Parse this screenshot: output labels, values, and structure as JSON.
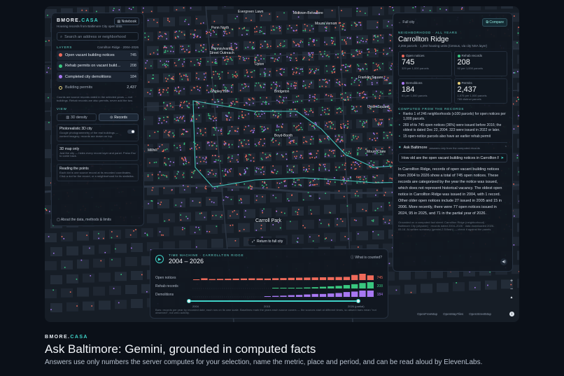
{
  "colors": {
    "accent": "#3fd2c7",
    "open_notices": "#ef6a5a",
    "rehab": "#39c77f",
    "demolitions": "#a878f2",
    "permits": "#e9d27a"
  },
  "map": {
    "place_labels": [
      "Evergreen Lawn",
      "Midtown-Belvedere",
      "Mount Vernon",
      "Penn North",
      "Pennsylvania Street Outreach",
      "Upton",
      "Shipley Hill",
      "Bridgeton",
      "Franklin Square",
      "Union Square",
      "Millhill",
      "Boyd-Booth",
      "Mount Clare",
      "Carroll Park"
    ],
    "return_button": "Return to full city",
    "zoom_in": "+",
    "zoom_out": "−",
    "compass": "▲",
    "attribution": [
      "OpenFreeMap",
      "OpenMapTiles",
      "OpenStreetMap"
    ],
    "info": "i"
  },
  "left": {
    "brand_a": "BMORE.",
    "brand_b": "CASA",
    "subtitle": "Housing records from Baltimore City open data",
    "notebook": "Notebook",
    "search_placeholder": "Search an address or neighborhood",
    "layers_title": "LAYERS",
    "layers_scope": "Carrollton Ridge · 2004–2026",
    "layers": [
      {
        "label": "Open vacant building notices",
        "count": "745",
        "color": "#ef6a5a"
      },
      {
        "label": "Rehab permits on vacant build…",
        "count": "208",
        "color": "#39c77f"
      },
      {
        "label": "Completed city demolitions",
        "count": "184",
        "color": "#a878f2"
      },
      {
        "label": "Building permits",
        "count": "2,437",
        "color": "#e9d27a"
      }
    ],
    "layers_note": "Counts are source records dated in the selected years — not buildings. Rehab records are also permits, never add the two.",
    "view_title": "VIEW",
    "view_density": "3D density",
    "view_records": "Records",
    "photo_title": "Photorealistic 3D city",
    "photo_desc": "Google photogrammetry of the real buildings — context imagery; records are drawn on top.",
    "maponly_title": "3D map only",
    "maponly_desc": "Just the city — hides every record layer and panel. Press Esc to come back.",
    "reading_title": "Reading the points",
    "reading_desc": "Each dot is one source record at its recorded coordinates. Click a dot for the record, or a neighborhood for its statistics.",
    "about": "About the data, methods & limits"
  },
  "right": {
    "back": "Full city",
    "compare": "Compare",
    "eyebrow": "NEIGHBORHOOD · ALL YEARS",
    "name": "Carrollton Ridge",
    "stats_line": "2,266 parcels · 1,283 housing units (Census, via city NSA layer)",
    "cards": [
      {
        "label": "Open notices",
        "value": "745",
        "sub": "329 per 1,000 parcels",
        "color": "#ef6a5a"
      },
      {
        "label": "Rehab records",
        "value": "208",
        "sub": "92 per 1,000 parcels",
        "color": "#39c77f"
      },
      {
        "label": "Demolitions",
        "value": "184",
        "sub": "81 per 1,000 parcels",
        "color": "#a878f2"
      },
      {
        "label": "Permits",
        "value": "2,437",
        "sub": "1,075 per 1,000 parcels",
        "sub2": "765 distinct parcels",
        "color": "#e9d27a"
      }
    ],
    "computed_title": "COMPUTED FROM THE RECORDS",
    "bullets": [
      "Ranks 1 of 246 neighborhoods (x100 parcels) for open notices per 1,000 parcels.",
      "269 of its 745 open notices (36%) were issued before 2016; the oldest is dated Dec 22, 2004. 323 were issued in 2022 or later.",
      "15 open-notice parcels also have an earlier rehab permit"
    ],
    "ask_title": "Ask Baltimore",
    "ask_meta": "answers only from the computed records",
    "question": "How old are the open vacant building notices in Carrollton Ridge?",
    "answer": "In Carrollton Ridge, records of open vacant building notices from 2004 to 2026 show a total of 745 open notices. These records are categorized by the year the notice was issued, which does not represent historical vacancy. The oldest open notice in Carrollton Ridge was issued in 2004, with 1 record. Other older open notices include 27 issued in 2005 and 15 in 2006. More recently, there were 77 open notices issued in 2024, 95 in 2025, and 71 in the partial year of 2026.",
    "footnote": "Grounded on a computed fact sheet: Carrollton Ridge (neighborhood) · Baltimore City (citywide) · records dated 2004–2026 · data downloaded 2026-05-16. AI-written summary (gemini-2.5-flash) — check it against the panels."
  },
  "time_machine": {
    "eyebrow": "TIME MACHINE · CARROLLTON RIDGE",
    "range": "2004 – 2026",
    "what": "What is counted?",
    "rows": [
      {
        "label": "Open notices",
        "total": "745",
        "color": "#ef6a5a",
        "values": [
          1,
          27,
          15,
          18,
          20,
          22,
          24,
          26,
          25,
          23,
          28,
          30,
          34,
          36,
          38,
          40,
          42,
          44,
          46,
          48,
          77,
          95,
          71
        ]
      },
      {
        "label": "Rehab records",
        "total": "208",
        "color": "#39c77f",
        "values": [
          0,
          0,
          0,
          0,
          0,
          0,
          0,
          0,
          0,
          0,
          1,
          2,
          3,
          5,
          7,
          9,
          12,
          15,
          18,
          24,
          30,
          38,
          44
        ]
      },
      {
        "label": "Demolitions",
        "total": "184",
        "color": "#a878f2",
        "values": [
          0,
          0,
          0,
          0,
          0,
          0,
          0,
          0,
          0,
          2,
          4,
          5,
          7,
          8,
          10,
          12,
          12,
          14,
          16,
          20,
          22,
          26,
          26
        ]
      }
    ],
    "tick_start": "2004",
    "tick_mid": "2015",
    "tick_end": "2026 (partial)",
    "note": "Bars: records per year by recorded date, each row on its own scale. Baselines mark the years each source covers — the sources start at different times, so absent bars mean \"not observed\", not zero activity."
  },
  "caption": {
    "brand_a": "BMORE.",
    "brand_b": "CASA",
    "title": "Ask Baltimore: Gemini, grounded in computed facts",
    "subtitle": "Answers use only numbers the server computes for your selection, name the metric, place and period, and can be read aloud by ElevenLabs."
  }
}
